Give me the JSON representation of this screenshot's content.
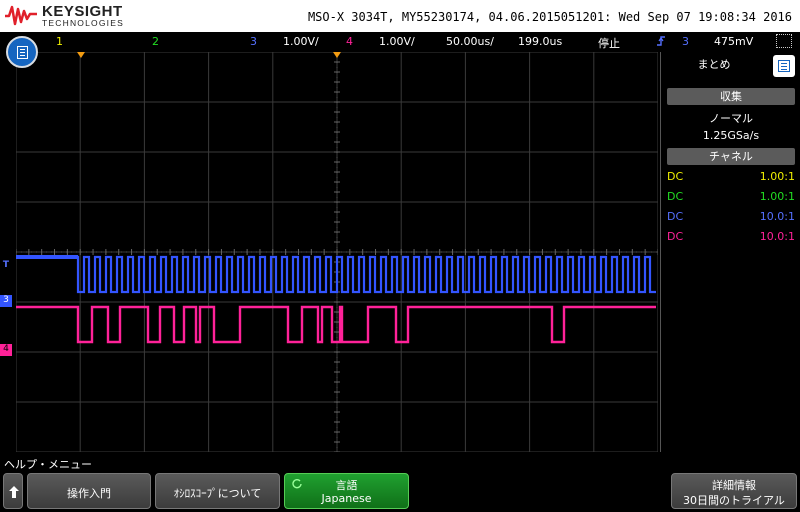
{
  "header": {
    "brand": "KEYSIGHT",
    "brand_sub": "TECHNOLOGIES",
    "instrument_info": "MSO-X 3034T, MY55230174, 04.06.2015051201: Wed Sep 07 19:08:34 2016"
  },
  "status": {
    "ch1": "1",
    "ch2": "2",
    "ch3": "3",
    "ch3_scale": "1.00V/",
    "ch4": "4",
    "ch4_scale": "1.00V/",
    "timebase": "50.00us/",
    "delay": "199.0us",
    "run_state": "停止",
    "trigger_source": "3",
    "trigger_level": "475mV"
  },
  "markers": {
    "trigger_level": "T",
    "ch3": "3",
    "ch4": "4"
  },
  "panel": {
    "title": "まとめ",
    "acq_header": "収集",
    "acq_mode": "ノーマル",
    "sample_rate": "1.25GSa/s",
    "channel_header": "チャネル",
    "channels": [
      {
        "coupling": "DC",
        "ratio": "1.00:1",
        "color": "#f0f000"
      },
      {
        "coupling": "DC",
        "ratio": "1.00:1",
        "color": "#22dd22"
      },
      {
        "coupling": "DC",
        "ratio": "10.0:1",
        "color": "#3355ff"
      },
      {
        "coupling": "DC",
        "ratio": "10.0:1",
        "color": "#ff2299"
      }
    ]
  },
  "softkeys": {
    "menu_title": "ヘルプ・メニュー",
    "intro": "操作入門",
    "about": "ｵｼﾛｽｺｰﾌﾟについて",
    "language_l1": "言語",
    "language_l2": "Japanese",
    "details_l1": "詳細情報",
    "details_l2": "30日間のトライアル"
  },
  "colors": {
    "ch1": "#f0f000",
    "ch2": "#22dd22",
    "ch3": "#3355ff",
    "ch4": "#ff2299",
    "softkey_active": "#20a030"
  },
  "icons": [
    "keysight-wave-icon",
    "menu-icon",
    "trigger-rising-edge-icon",
    "popout-icon",
    "up-arrow-icon"
  ]
}
